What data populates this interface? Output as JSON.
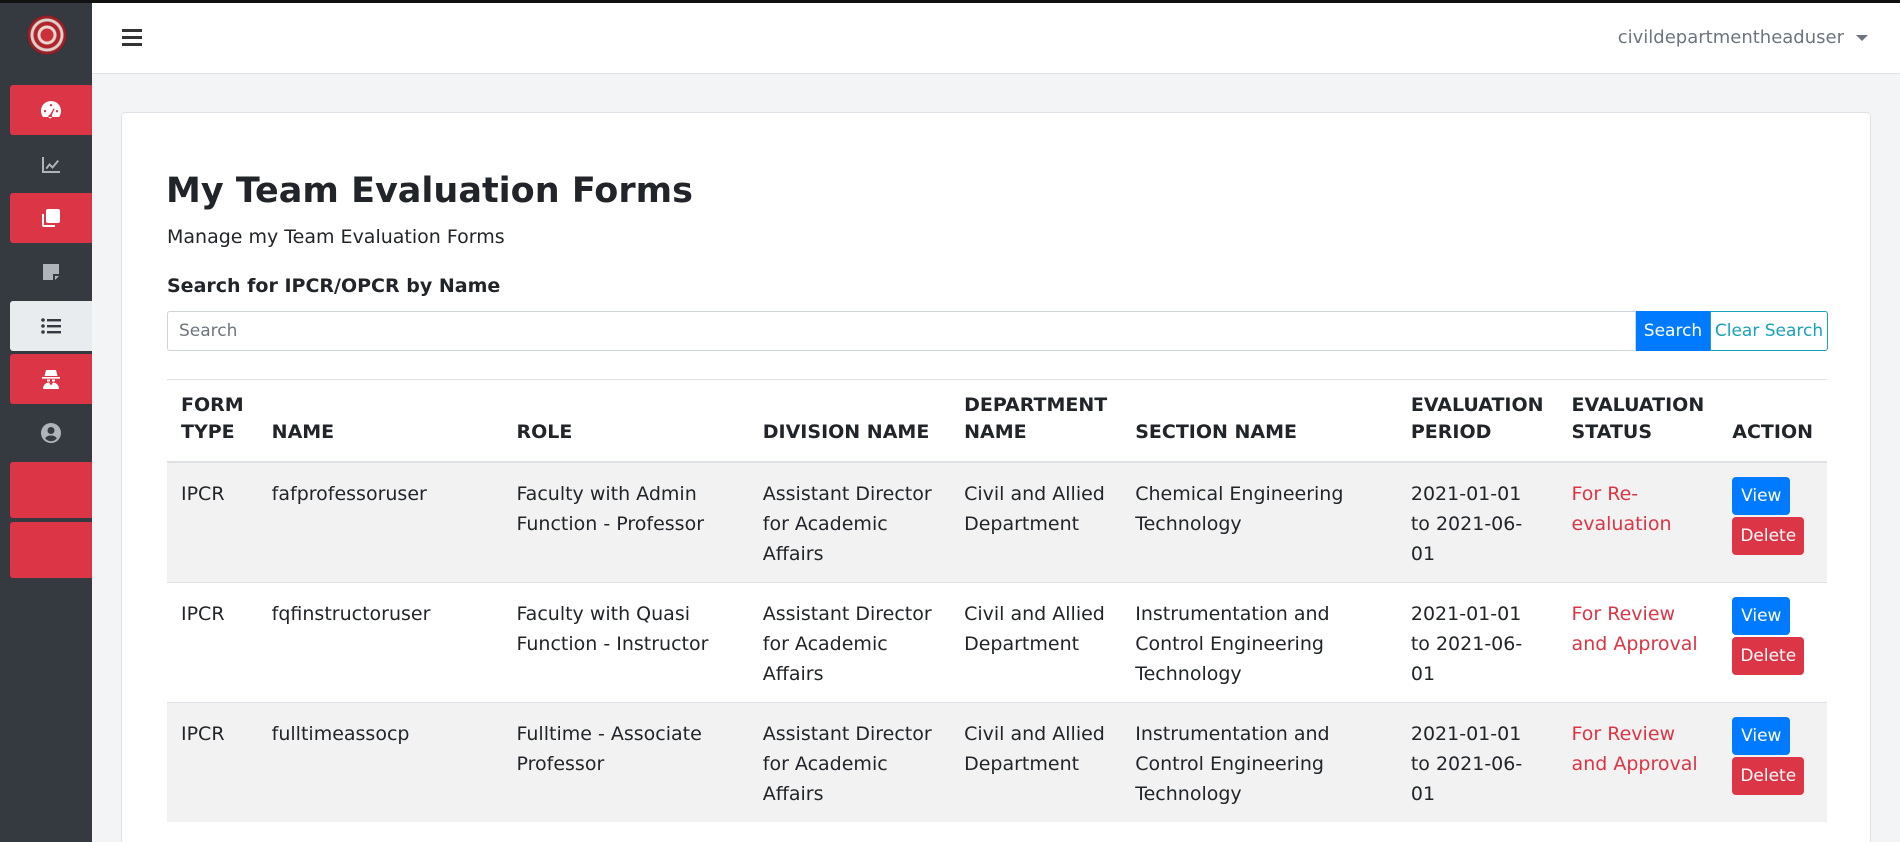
{
  "navbar": {
    "username": "civildepartmentheaduser"
  },
  "sidebar": {
    "items": [
      {
        "icon": "dashboard-gauge-icon"
      },
      {
        "icon": "chart-line-icon"
      },
      {
        "icon": "copy-icon"
      },
      {
        "icon": "sticky-note-icon"
      },
      {
        "icon": "list-icon"
      },
      {
        "icon": "user-secret-icon"
      },
      {
        "icon": "user-circle-icon"
      }
    ]
  },
  "page": {
    "title": "My Team Evaluation Forms",
    "subtitle": "Manage my Team Evaluation Forms"
  },
  "search": {
    "label": "Search for IPCR/OPCR by Name",
    "placeholder": "Search",
    "value": "",
    "search_button": "Search",
    "clear_button": "Clear Search"
  },
  "table": {
    "headers": [
      "FORM TYPE",
      "NAME",
      "ROLE",
      "DIVISION NAME",
      "DEPARTMENT NAME",
      "SECTION NAME",
      "EVALUATION PERIOD",
      "EVALUATION STATUS",
      "ACTION"
    ],
    "rows": [
      {
        "form_type": "IPCR",
        "name": "fafprofessoruser",
        "role": "Faculty with Admin Function - Professor",
        "division": "Assistant Director for Academic Affairs",
        "department": "Civil and Allied Department",
        "section": "Chemical Engineering Technology",
        "period": "2021-01-01 to 2021-06-01",
        "status": "For Re-evaluation",
        "view_label": "View",
        "delete_label": "Delete"
      },
      {
        "form_type": "IPCR",
        "name": "fqfinstructoruser",
        "role": "Faculty with Quasi Function - Instructor",
        "division": "Assistant Director for Academic Affairs",
        "department": "Civil and Allied Department",
        "section": "Instrumentation and Control Engineering Technology",
        "period": "2021-01-01 to 2021-06-01",
        "status": "For Review and Approval",
        "view_label": "View",
        "delete_label": "Delete"
      },
      {
        "form_type": "IPCR",
        "name": "fulltimeassocp",
        "role": "Fulltime - Associate Professor",
        "division": "Assistant Director for Academic Affairs",
        "department": "Civil and Allied Department",
        "section": "Instrumentation and Control Engineering Technology",
        "period": "2021-01-01 to 2021-06-01",
        "status": "For Review and Approval",
        "view_label": "View",
        "delete_label": "Delete"
      }
    ]
  },
  "colors": {
    "sidebar_bg": "#343a40",
    "accent_red": "#dc3545",
    "primary_blue": "#007bff",
    "info_teal": "#17a2b8"
  }
}
